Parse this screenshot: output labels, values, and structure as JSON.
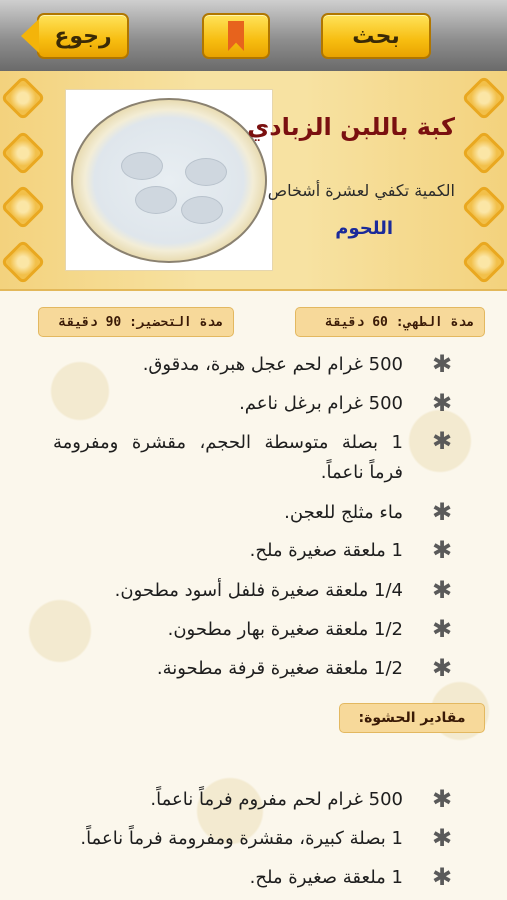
{
  "toolbar": {
    "back_label": "رجوع",
    "search_label": "بحث"
  },
  "recipe": {
    "title": "كبة باللبن الزبادي",
    "serves": "الكمية تكفي لعشرة أشخاص",
    "category": "اللحوم",
    "cook_time_label": "مدة الطهي:",
    "cook_time_value": "60 دقيقة",
    "prep_time_label": "مدة التحضير:",
    "prep_time_value": "90 دقيقة"
  },
  "ingredients": [
    "500 غرام لحم عجل هبرة، مدقوق.",
    "500 غرام برغل ناعم.",
    "1 بصلة متوسطة الحجم، مقشرة ومفرومة فرماً ناعماً.",
    "ماء مثلج للعجن.",
    "1 ملعقة صغيرة ملح.",
    "1/4 ملعقة صغيرة فلفل أسود مطحون.",
    "1/2 ملعقة صغيرة بهار مطحون.",
    "1/2 ملعقة صغيرة قرفة مطحونة."
  ],
  "filling_section": "مقادير الحشوة:",
  "filling": [
    "500 غرام لحم مفروم فرماً ناعماً.",
    "1 بصلة كبيرة، مقشرة ومفرومة فرماً ناعماً.",
    "1 ملعقة صغيرة ملح."
  ],
  "icons": {
    "back": "back-arrow-icon",
    "bookmark": "bookmark-icon",
    "bullet": "asterisk-bullet-icon"
  },
  "colors": {
    "button": "#f7bd10",
    "title": "#7a1010",
    "category": "#1a2a9a",
    "badge": "#f7d99a"
  }
}
